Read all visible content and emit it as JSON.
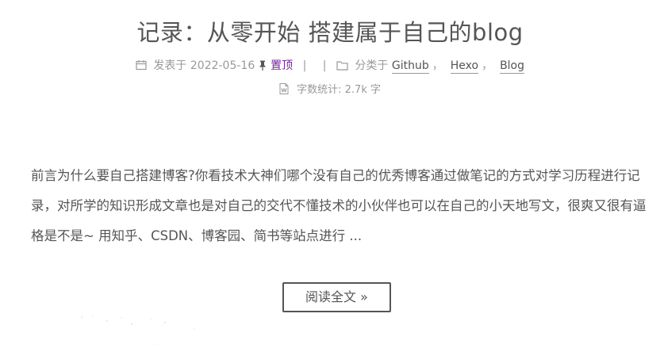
{
  "post": {
    "title": "记录：从零开始 搭建属于自己的blog",
    "meta": {
      "posted_label": "发表于",
      "posted_date": "2022-05-16",
      "sticky_label": "置顶",
      "separator": "|",
      "category_label": "分类于",
      "categories": [
        "Github",
        "Hexo",
        "Blog"
      ],
      "category_separator": "，",
      "icons": {
        "calendar": "calendar-icon",
        "pin": "pushpin-icon",
        "folder": "folder-icon",
        "word": "word-file-icon"
      }
    },
    "wordcount": {
      "label": "字数统计:",
      "value": "2.7k",
      "unit": "字"
    },
    "excerpt": "前言为什么要自己搭建博客?你看技术大神们哪个没有自己的优秀博客通过做笔记的方式对学习历程进行记录，对所学的知识形成文章也是对自己的交代不懂技术的小伙伴也可以在自己的小天地写文，很爽又很有逼格是不是~ 用知乎、CSDN、博客园、简书等站点进行 ...",
    "read_more_label": "阅读全文 »"
  },
  "colors": {
    "text": "#555555",
    "meta": "#999999",
    "sticky": "#7a1fa2",
    "background": "#ffffff"
  }
}
